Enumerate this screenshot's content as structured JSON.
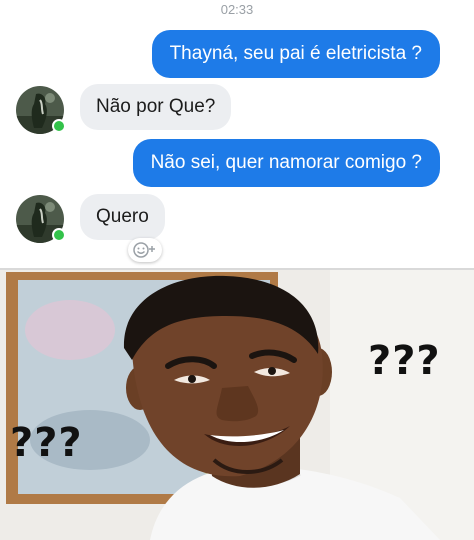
{
  "chat": {
    "timestamp": "02:33",
    "messages": [
      {
        "direction": "outgoing",
        "text": "Thayná, seu pai é eletricista ?"
      },
      {
        "direction": "incoming",
        "text": "Não por Que?"
      },
      {
        "direction": "outgoing",
        "text": "Não sei, quer namorar comigo ?"
      },
      {
        "direction": "incoming",
        "text": "Quero"
      }
    ],
    "colors": {
      "outgoing_bubble": "#1e7be8",
      "incoming_bubble": "#eceef1",
      "online_dot": "#33c24a"
    },
    "icons": {
      "add_reaction": "smiley-plus-icon",
      "online_status": "online-dot-icon"
    }
  },
  "meme": {
    "caption_right": "???",
    "caption_left": "???"
  }
}
